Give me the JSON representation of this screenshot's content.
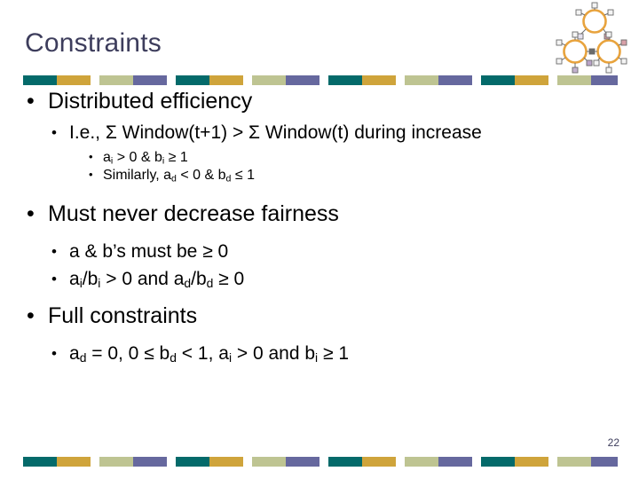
{
  "slide": {
    "title": "Constraints",
    "page_number": "22",
    "title_color": "#3d3d5c"
  },
  "decoration": {
    "chem_diagram_name": "benzene-rings-diagram",
    "ring_color": "#E8A33D",
    "node_color": "#f2f2f2",
    "stripe_colors": {
      "teal": "#046a6a",
      "gold": "#cfa43b",
      "sage": "#bec492",
      "slate": "#66689e"
    }
  },
  "content": {
    "bullets": [
      {
        "level": 1,
        "marker": "•",
        "text": "Distributed efficiency"
      },
      {
        "level": 2,
        "marker": "•",
        "line1": "I.e., Σ Window(t+1) > Σ Window(t) during",
        "line2": "increase"
      },
      {
        "level": 3,
        "marker": "•",
        "parts": [
          "a",
          "i",
          " > 0 & b",
          "i",
          " ≥ 1"
        ]
      },
      {
        "level": 3,
        "marker": "•",
        "parts": [
          "Similarly, a",
          "d",
          " < 0 & b",
          "d",
          " ≤ 1"
        ]
      },
      {
        "level": 1,
        "marker": "•",
        "text": "Must never decrease fairness"
      },
      {
        "level": 2,
        "marker": "•",
        "text": "a & b’s must be ≥ 0"
      },
      {
        "level": 2,
        "marker": "•",
        "parts": [
          "a",
          "i",
          "/b",
          "i",
          " > 0 and a",
          "d",
          "/b",
          "d",
          " ≥ 0"
        ]
      },
      {
        "level": 1,
        "marker": "•",
        "text": "Full constraints"
      },
      {
        "level": 2,
        "marker": "•",
        "parts": [
          "a",
          "d",
          " = 0,  0 ≤ b",
          "d",
          " < 1, a",
          "i",
          " > 0 and b",
          "i",
          " ≥ 1"
        ]
      }
    ]
  }
}
